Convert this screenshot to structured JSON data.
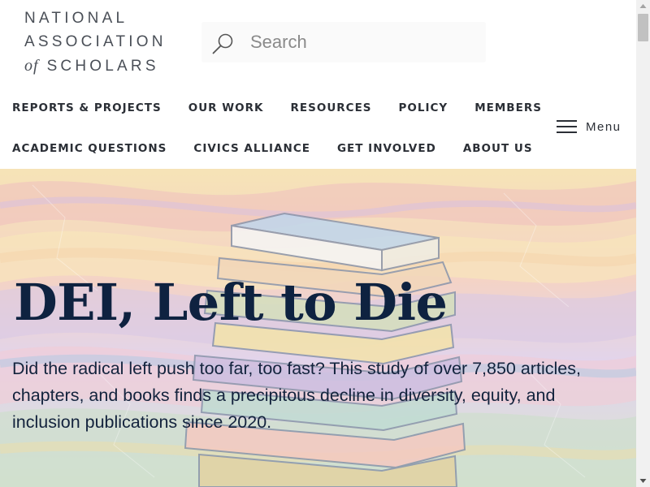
{
  "logo": {
    "line1": "NATIONAL",
    "line2": "ASSOCIATION",
    "line3_of": "of",
    "line3_rest": "SCHOLARS"
  },
  "search": {
    "placeholder": "Search",
    "icon": "search-icon"
  },
  "nav": {
    "row1": [
      "REPORTS & PROJECTS",
      "OUR WORK",
      "RESOURCES",
      "POLICY",
      "MEMBERS"
    ],
    "row2": [
      "ACADEMIC QUESTIONS",
      "CIVICS ALLIANCE",
      "GET INVOLVED",
      "ABOUT US"
    ],
    "menu_label": "Menu",
    "menu_icon": "hamburger-icon"
  },
  "hero": {
    "title": "DEI, Left to Die",
    "text": "Did the radical left push too far, too fast? This study of over 7,850 articles, chapters, and books finds a precipitous decline in diversity, equity, and inclusion publications since 2020.",
    "image": "stack-of-books-illustration"
  },
  "colors": {
    "title": "#0e2240",
    "nav_text": "#2b2f36",
    "logo_text": "#4a4f57"
  }
}
